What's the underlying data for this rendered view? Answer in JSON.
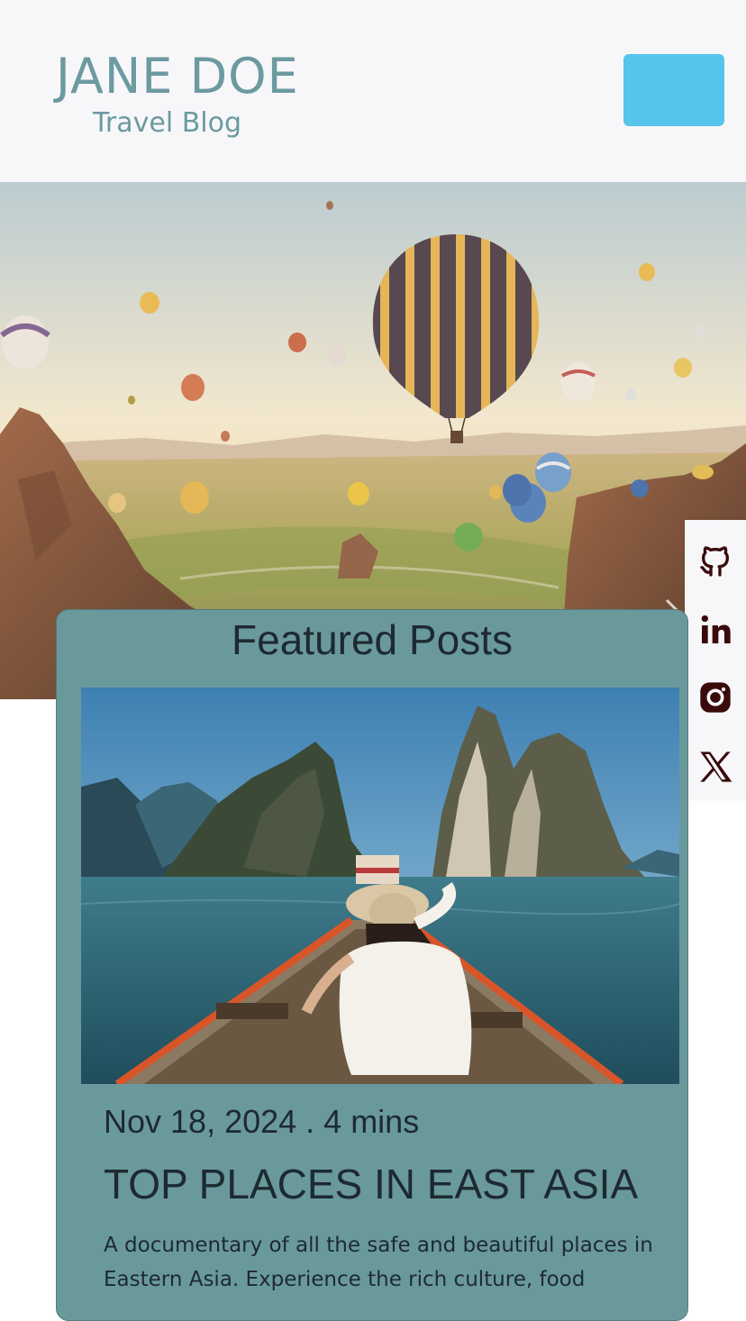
{
  "header": {
    "brand_name": "JANE DOE",
    "brand_subtitle": "Travel Blog",
    "menu_button_color": "#56c5ec"
  },
  "hero": {
    "image_subject": "hot-air-balloons-over-valley",
    "next_icon": "chevron-right-icon"
  },
  "social": [
    {
      "name": "github",
      "icon": "github-icon"
    },
    {
      "name": "linkedin",
      "icon": "linkedin-icon"
    },
    {
      "name": "instagram",
      "icon": "instagram-icon"
    },
    {
      "name": "x",
      "icon": "x-icon"
    }
  ],
  "featured": {
    "heading": "Featured Posts",
    "post": {
      "image_subject": "woman-on-longtail-boat-limestone-cliffs",
      "date": "Nov 18, 2024",
      "separator": " . ",
      "read_time": "4 mins",
      "title": "TOP PLACES IN EAST ASIA",
      "excerpt": "A documentary of all the safe and beautiful places in Eastern Asia. Experience the rich culture, food"
    }
  },
  "colors": {
    "header_bg": "#f7f7fa",
    "brand": "#6b9aa0",
    "card_bg": "#6a999c",
    "text_dark": "#1d2a30",
    "social_icon": "#3a0a0a"
  }
}
